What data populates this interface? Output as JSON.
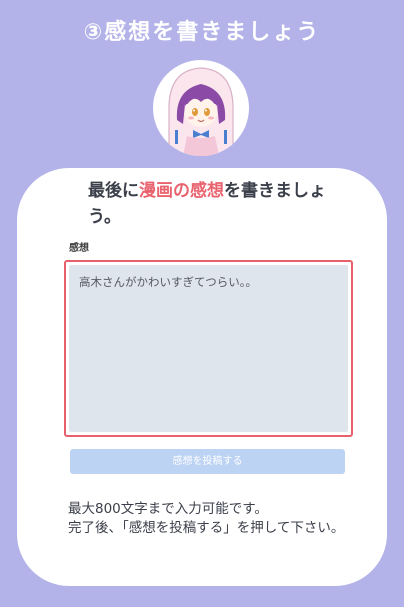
{
  "header": {
    "step_title": "③感想を書きましょう"
  },
  "avatar": {
    "icon": "character-avatar"
  },
  "card": {
    "heading_prefix": "最後に",
    "heading_highlight": "漫画の感想",
    "heading_suffix": "を書きましょう。",
    "field_label": "感想",
    "textarea_value": "高木さんがかわいすぎてつらい。。",
    "submit_label": "感想を投稿する",
    "note_line1": "最大800文字まで入力可能です。",
    "note_line2": "完了後、「感想を投稿する」を押して下さい。"
  },
  "colors": {
    "background": "#b3b3ea",
    "highlight": "#e9636f",
    "textarea_border": "#e8606b",
    "textarea_fill": "#dfe5ed",
    "button_disabled": "#bdd3f4"
  }
}
